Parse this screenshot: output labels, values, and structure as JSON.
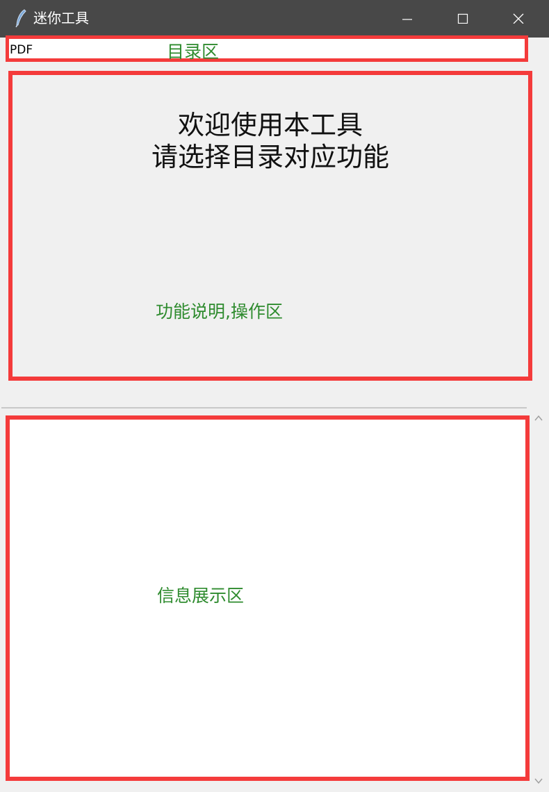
{
  "window": {
    "title": "迷你工具",
    "icon": "feather-icon",
    "controls": [
      "minimize-icon",
      "maximize-icon",
      "close-icon"
    ]
  },
  "menu": {
    "items": [
      {
        "label": "PDF"
      }
    ]
  },
  "content": {
    "welcome_line1": "欢迎使用本工具",
    "welcome_line2": "请选择目录对应功能"
  },
  "annotations": {
    "menu_area": "目录区",
    "content_area": "功能说明,操作区",
    "info_area": "信息展示区",
    "highlight_color": "#f43b3b",
    "label_color": "#2e8b2e"
  },
  "scrollbar": {
    "up_icon": "chevron-up-icon",
    "down_icon": "chevron-down-icon"
  }
}
